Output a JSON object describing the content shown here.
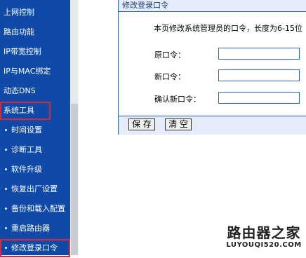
{
  "sidebar": {
    "items": [
      {
        "label": "上网控制",
        "sub": false
      },
      {
        "label": "路由功能",
        "sub": false
      },
      {
        "label": "IP带宽控制",
        "sub": false
      },
      {
        "label": "IP与MAC绑定",
        "sub": false
      },
      {
        "label": "动态DNS",
        "sub": false
      },
      {
        "label": "系统工具",
        "sub": false,
        "highlighted": true
      },
      {
        "label": "时间设置",
        "sub": true
      },
      {
        "label": "诊断工具",
        "sub": true
      },
      {
        "label": "软件升级",
        "sub": true
      },
      {
        "label": "恢复出厂设置",
        "sub": true
      },
      {
        "label": "备份和载入配置",
        "sub": true
      },
      {
        "label": "重启路由器",
        "sub": true
      },
      {
        "label": "修改登录口令",
        "sub": true,
        "highlighted": true
      }
    ],
    "highlight_color": "#d8283c",
    "background_color": "#0f4aa8"
  },
  "panel": {
    "title": "修改登录口令",
    "description": "本页修改系统管理员的口令，长度为6-15位",
    "fields": [
      {
        "label": "原口令：",
        "value": ""
      },
      {
        "label": "新口令：",
        "value": ""
      },
      {
        "label": "确认新口令：",
        "value": ""
      }
    ],
    "buttons": {
      "save": "保 存",
      "clear": "清 空"
    }
  },
  "watermark": {
    "title": "路由器之家",
    "url": "LUYOUQI520.COM"
  }
}
